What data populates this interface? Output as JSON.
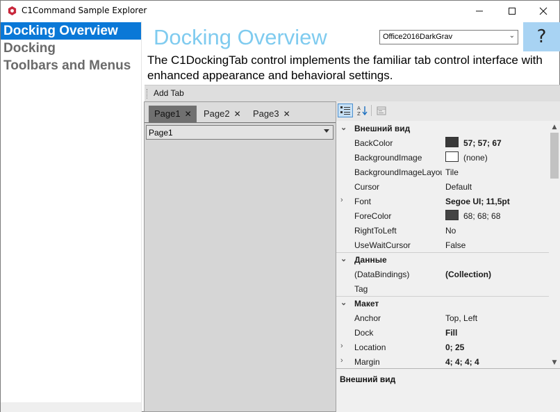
{
  "window": {
    "title": "C1Command Sample Explorer",
    "minimize_glyph": "—",
    "maximize_glyph": "☐",
    "close_glyph": "✕"
  },
  "sidebar": {
    "items": [
      {
        "label": "Docking Overview",
        "selected": true
      },
      {
        "label": "Docking",
        "selected": false
      },
      {
        "label": "Toolbars and Menus",
        "selected": false
      }
    ]
  },
  "header": {
    "title": "Docking Overview",
    "theme_value": "Office2016DarkGrav",
    "help_glyph": "?"
  },
  "description": "The C1DockingTab control implements the familiar tab control interface with enhanced appearance and behavioral settings.",
  "toolbar": {
    "add_tab_label": "Add Tab"
  },
  "tabs": [
    {
      "label": "Page1",
      "close": "✕",
      "active": true
    },
    {
      "label": "Page2",
      "close": "✕",
      "active": false
    },
    {
      "label": "Page3",
      "close": "✕",
      "active": false
    }
  ],
  "page_combo_value": "Page1",
  "property_grid": {
    "rows": [
      {
        "type": "category",
        "expander": "⌄",
        "name": "Внешний вид"
      },
      {
        "type": "prop",
        "name": "BackColor",
        "swatch": "#393939",
        "value": "57; 57; 67",
        "bold": true
      },
      {
        "type": "prop",
        "name": "BackgroundImage",
        "swatch": "#ffffff",
        "value": "(none)",
        "bold": false
      },
      {
        "type": "prop",
        "name": "BackgroundImageLayout",
        "value": "Tile",
        "bold": false
      },
      {
        "type": "prop",
        "name": "Cursor",
        "value": "Default",
        "bold": false
      },
      {
        "type": "prop",
        "expander": "›",
        "name": "Font",
        "value": "Segoe UI; 11,5pt",
        "bold": true
      },
      {
        "type": "prop",
        "name": "ForeColor",
        "swatch": "#444444",
        "value": "68; 68; 68",
        "bold": false
      },
      {
        "type": "prop",
        "name": "RightToLeft",
        "value": "No",
        "bold": false
      },
      {
        "type": "prop",
        "name": "UseWaitCursor",
        "value": "False",
        "bold": false
      },
      {
        "type": "category",
        "expander": "⌄",
        "name": "Данные"
      },
      {
        "type": "prop",
        "name": "(DataBindings)",
        "value": "(Collection)",
        "bold": true
      },
      {
        "type": "prop",
        "name": "Tag",
        "value": "",
        "bold": false
      },
      {
        "type": "category",
        "expander": "⌄",
        "name": "Макет"
      },
      {
        "type": "prop",
        "name": "Anchor",
        "value": "Top, Left",
        "bold": false
      },
      {
        "type": "prop",
        "name": "Dock",
        "value": "Fill",
        "bold": true
      },
      {
        "type": "prop",
        "expander": "›",
        "name": "Location",
        "value": "0; 25",
        "bold": true
      },
      {
        "type": "prop",
        "expander": "›",
        "name": "Margin",
        "value": "4; 4; 4; 4",
        "bold": true
      }
    ],
    "description_title": "Внешний вид"
  },
  "colors": {
    "accent": "#0a78d7",
    "title": "#7fcbef",
    "help_bg": "#a8d3f3"
  }
}
